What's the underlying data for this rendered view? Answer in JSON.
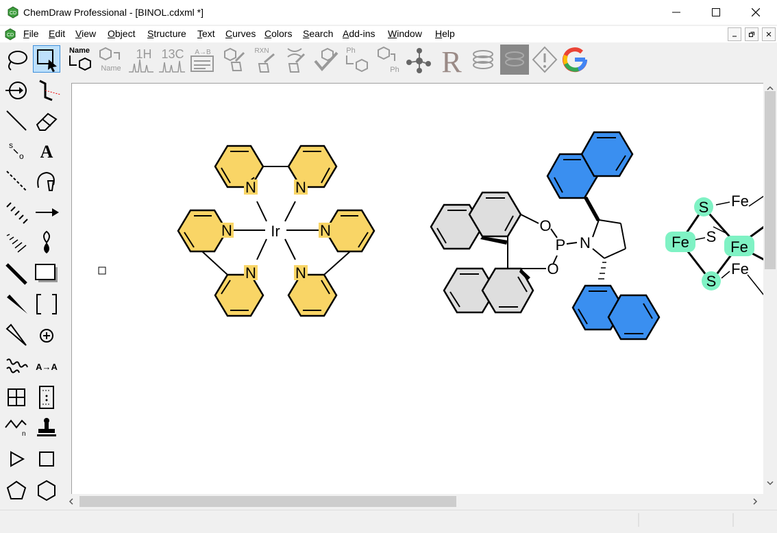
{
  "window": {
    "title": "ChemDraw Professional - [BINOL.cdxml *]"
  },
  "menu": {
    "items": [
      "File",
      "Edit",
      "View",
      "Object",
      "Structure",
      "Text",
      "Curves",
      "Colors",
      "Search",
      "Add-ins",
      "Window",
      "Help"
    ]
  },
  "toolbar": {
    "name_label": "Name",
    "name_sub": "Name",
    "h1_label": "1H",
    "c13_label": "13C",
    "ab_label": "A→B",
    "rxn_label": "RXN",
    "ph_top": "Ph",
    "ph_bottom": "Ph",
    "r_label": "R",
    "icons": [
      "structure-to-name-icon",
      "name-to-structure-icon",
      "1h-nmr-icon",
      "13c-nmr-icon",
      "chemical-properties-icon",
      "clean-structure-icon",
      "clean-reaction-icon",
      "clean-biopolymer-icon",
      "check-structure-icon",
      "expand-label-icon",
      "contract-label-icon",
      "molecule-3d-icon",
      "r-group-icon",
      "stack-icon",
      "grayed-tool-icon",
      "warning-icon",
      "google-search-icon"
    ]
  },
  "tools": {
    "text_tool": "A",
    "atom_map": "A→A",
    "oxygen_sub": "o",
    "sulfur_label": "s",
    "n_sub": "n"
  },
  "colors": {
    "accent": "#3d8fdb",
    "pyridine": "#f9d566",
    "naphthyl_blue": "#3a8ff0",
    "binol_gray": "#dedede",
    "iron_sulfur": "#7ff2c4"
  },
  "canvas": {
    "ir_complex": {
      "metal": "Ir",
      "ligand_atom": "N"
    },
    "phosphoramidite": {
      "phosphorus": "P",
      "oxygen": "O",
      "nitrogen": "N"
    },
    "cluster": {
      "iron": "Fe",
      "sulfur": "S"
    }
  }
}
